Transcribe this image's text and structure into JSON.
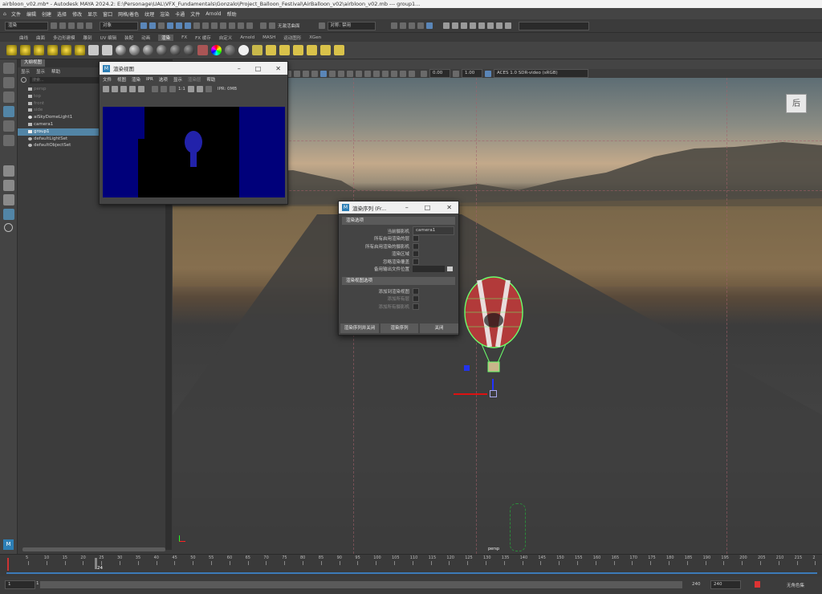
{
  "window": {
    "title": "airbloon_v02.mb* - Autodesk MAYA 2024.2: E:\\Personage\\UAL\\VFX_Fundamentals\\Gonzalo\\Project_Balloon_Festival\\AirBalloon_v02\\airbloon_v02.mb    ---    group1..."
  },
  "menubar": [
    "文件",
    "编辑",
    "创建",
    "选择",
    "修改",
    "显示",
    "窗口",
    "网格/着色",
    "纹理",
    "渲染",
    "卡通",
    "文件",
    "Arnold",
    "帮助"
  ],
  "status": {
    "mode": "渲染",
    "object_label": "对象",
    "live_surface": "无激活曲面",
    "symmetry": "对称: 禁用"
  },
  "shelf_tabs": [
    "曲线",
    "曲面",
    "多边形建模",
    "雕刻",
    "UV 编辑",
    "装配",
    "动画",
    "渲染",
    "FX",
    "FX 缓存",
    "自定义",
    "Arnold",
    "MASH",
    "运动图形",
    "XGen"
  ],
  "shelf_active": "渲染",
  "outliner": {
    "title": "大纲视图",
    "menu": [
      "显示",
      "显示",
      "帮助"
    ],
    "search_placeholder": "搜索...",
    "items": [
      {
        "name": "persp",
        "dim": true
      },
      {
        "name": "top",
        "dim": true
      },
      {
        "name": "front",
        "dim": true
      },
      {
        "name": "side",
        "dim": true
      },
      {
        "name": "aiSkyDomeLight1",
        "dim": false
      },
      {
        "name": "camera1",
        "dim": false
      },
      {
        "name": "group1",
        "dim": false,
        "selected": true
      },
      {
        "name": "defaultLightSet",
        "dim": false
      },
      {
        "name": "defaultObjectSet",
        "dim": false
      }
    ]
  },
  "viewport": {
    "exposure": "0.00",
    "gamma": "1.00",
    "color_space": "ACES 1.0 SDR-video (sRGB)",
    "view_cube_label": "后",
    "camera_label": "persp"
  },
  "render_view": {
    "title": "渲染视图",
    "menu": [
      "文件",
      "视图",
      "渲染",
      "IPR",
      "选项",
      "显示",
      "渲染层",
      "帮助"
    ],
    "ratio": "1:1",
    "ipr_label": "IPR: 0MB"
  },
  "render_sequence": {
    "title": "渲染序列 (Fr...",
    "section1": "渲染选项",
    "camera_label": "当前摄影机",
    "camera_value": "camera1",
    "options": [
      "所有启用渲染的层",
      "所有启用渲染的摄影机",
      "渲染区域",
      "忽略渲染覆盖",
      "备用输出文件位置"
    ],
    "section2": "渲染视图选项",
    "view_options": [
      "添加到渲染视图",
      "添加所有层",
      "添加所有摄影机"
    ],
    "buttons": [
      "渲染序列并关闭",
      "渲染序列",
      "关闭"
    ]
  },
  "timeline": {
    "ticks": [
      "5",
      "10",
      "15",
      "20",
      "25",
      "30",
      "35",
      "40",
      "45",
      "50",
      "55",
      "60",
      "65",
      "70",
      "75",
      "80",
      "85",
      "90",
      "95",
      "100",
      "105",
      "110",
      "115",
      "120",
      "125",
      "130",
      "135",
      "140",
      "145",
      "150",
      "155",
      "160",
      "165",
      "170",
      "175",
      "180",
      "185",
      "190",
      "195",
      "200",
      "205",
      "210",
      "215",
      "2"
    ],
    "current_frame": "24"
  },
  "range": {
    "start": "1",
    "start2": "1",
    "end": "240",
    "end2": "240",
    "anim_layer": "无角色集"
  }
}
